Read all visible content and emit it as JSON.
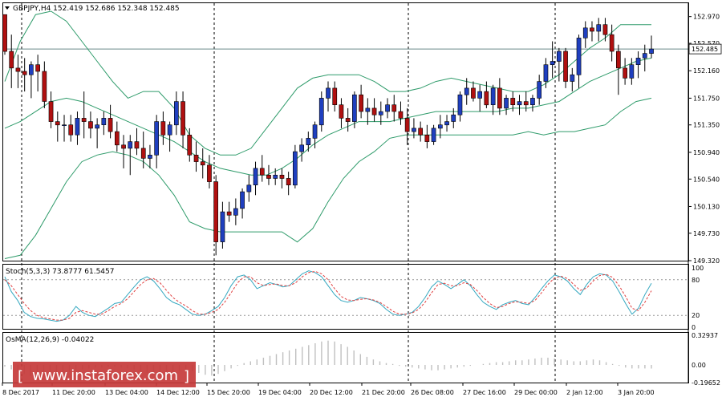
{
  "header": {
    "main_info": "GBPJPY,H4  152.419 152.686 152.348 152.485",
    "stoch_info": "Stoch(5,3,3) 73.8777 61.5457",
    "osma_info": "OsMA(12,26,9) -0.04022"
  },
  "watermark": {
    "text": "www.instaforex.com"
  },
  "colors": {
    "bull": "#1f3fbf",
    "bear": "#b01010",
    "bands": "#2e9b6a",
    "stoch_main": "#35a8c0",
    "stoch_signal": "#e04040",
    "osma": "#c0c0c0",
    "watermark_bg": "#c53a3a"
  },
  "chart_data": {
    "type": "candlestick",
    "symbol": "GBPJPY",
    "timeframe": "H4",
    "price_axis": {
      "ylim": [
        149.32,
        153.17
      ],
      "ticks": [
        "152.970",
        "152.570",
        "152.160",
        "151.750",
        "151.350",
        "150.940",
        "150.540",
        "150.130",
        "149.730",
        "149.320"
      ],
      "current_price": "152.485"
    },
    "time_axis": {
      "labels": [
        "8 Dec 2017",
        "11 Dec 20:00",
        "13 Dec 04:00",
        "14 Dec 12:00",
        "15 Dec 20:00",
        "19 Dec 04:00",
        "20 Dec 12:00",
        "21 Dec 20:00",
        "26 Dec 08:00",
        "27 Dec 16:00",
        "29 Dec 00:00",
        "2 Jan 12:00",
        "3 Jan 20:00"
      ]
    },
    "ohlc": [
      [
        153.0,
        152.85,
        152.4,
        152.45
      ],
      [
        152.45,
        152.7,
        151.9,
        152.2
      ],
      [
        152.2,
        152.4,
        151.9,
        152.15
      ],
      [
        152.15,
        152.35,
        151.85,
        152.1
      ],
      [
        152.1,
        152.3,
        151.75,
        152.25
      ],
      [
        152.25,
        152.4,
        151.85,
        152.15
      ],
      [
        152.15,
        152.3,
        151.6,
        151.7
      ],
      [
        151.7,
        151.85,
        151.3,
        151.4
      ],
      [
        151.4,
        151.55,
        151.1,
        151.35
      ],
      [
        151.35,
        151.5,
        151.1,
        151.35
      ],
      [
        151.35,
        151.5,
        151.1,
        151.2
      ],
      [
        151.2,
        151.55,
        151.05,
        151.45
      ],
      [
        151.45,
        151.85,
        151.15,
        151.4
      ],
      [
        151.4,
        151.55,
        151.15,
        151.3
      ],
      [
        151.3,
        151.45,
        151.0,
        151.35
      ],
      [
        151.35,
        151.55,
        151.2,
        151.45
      ],
      [
        151.45,
        151.65,
        151.15,
        151.25
      ],
      [
        151.25,
        151.4,
        150.95,
        151.05
      ],
      [
        151.05,
        151.2,
        150.7,
        151.0
      ],
      [
        151.0,
        151.2,
        150.6,
        151.1
      ],
      [
        151.1,
        151.3,
        150.9,
        151.0
      ],
      [
        151.0,
        151.25,
        150.7,
        150.85
      ],
      [
        150.85,
        151.05,
        150.7,
        150.9
      ],
      [
        150.9,
        151.5,
        150.7,
        151.4
      ],
      [
        151.4,
        151.55,
        151.05,
        151.2
      ],
      [
        151.2,
        151.4,
        150.95,
        151.35
      ],
      [
        151.35,
        151.85,
        151.2,
        151.7
      ],
      [
        151.7,
        151.85,
        151.0,
        151.2
      ],
      [
        151.2,
        151.3,
        150.8,
        150.9
      ],
      [
        150.9,
        151.1,
        150.65,
        150.8
      ],
      [
        150.8,
        151.0,
        150.55,
        150.75
      ],
      [
        150.75,
        150.9,
        150.4,
        150.5
      ],
      [
        150.5,
        150.6,
        149.4,
        149.6
      ],
      [
        149.6,
        150.2,
        149.5,
        150.05
      ],
      [
        150.05,
        150.2,
        149.9,
        150.0
      ],
      [
        150.0,
        150.25,
        149.85,
        150.1
      ],
      [
        150.1,
        150.4,
        149.95,
        150.35
      ],
      [
        150.35,
        150.6,
        150.2,
        150.45
      ],
      [
        150.45,
        150.8,
        150.3,
        150.7
      ],
      [
        150.7,
        150.9,
        150.5,
        150.6
      ],
      [
        150.6,
        150.75,
        150.45,
        150.55
      ],
      [
        150.55,
        150.7,
        150.45,
        150.6
      ],
      [
        150.6,
        150.7,
        150.4,
        150.55
      ],
      [
        150.55,
        150.65,
        150.3,
        150.45
      ],
      [
        150.45,
        151.05,
        150.4,
        150.95
      ],
      [
        150.95,
        151.15,
        150.8,
        151.05
      ],
      [
        151.05,
        151.25,
        150.95,
        151.15
      ],
      [
        151.15,
        151.4,
        151.0,
        151.35
      ],
      [
        151.35,
        151.85,
        151.25,
        151.75
      ],
      [
        151.75,
        152.0,
        151.55,
        151.9
      ],
      [
        151.9,
        152.0,
        151.55,
        151.65
      ],
      [
        151.65,
        151.75,
        151.3,
        151.45
      ],
      [
        151.45,
        151.6,
        151.25,
        151.4
      ],
      [
        151.4,
        151.85,
        151.3,
        151.8
      ],
      [
        151.8,
        151.95,
        151.45,
        151.55
      ],
      [
        151.55,
        151.75,
        151.35,
        151.6
      ],
      [
        151.6,
        151.75,
        151.4,
        151.5
      ],
      [
        151.5,
        151.7,
        151.35,
        151.55
      ],
      [
        151.55,
        151.75,
        151.45,
        151.65
      ],
      [
        151.65,
        151.8,
        151.4,
        151.55
      ],
      [
        151.55,
        151.7,
        151.35,
        151.45
      ],
      [
        151.45,
        151.6,
        151.05,
        151.25
      ],
      [
        151.25,
        151.45,
        151.15,
        151.3
      ],
      [
        151.3,
        151.4,
        151.1,
        151.2
      ],
      [
        151.2,
        151.35,
        151.0,
        151.1
      ],
      [
        151.1,
        151.35,
        151.05,
        151.3
      ],
      [
        151.3,
        151.5,
        151.15,
        151.35
      ],
      [
        151.35,
        151.5,
        151.25,
        151.4
      ],
      [
        151.4,
        151.6,
        151.3,
        151.5
      ],
      [
        151.5,
        151.85,
        151.4,
        151.8
      ],
      [
        151.8,
        152.05,
        151.65,
        151.9
      ],
      [
        151.9,
        152.0,
        151.7,
        151.75
      ],
      [
        151.75,
        151.95,
        151.55,
        151.85
      ],
      [
        151.85,
        152.0,
        151.6,
        151.65
      ],
      [
        151.65,
        151.95,
        151.5,
        151.9
      ],
      [
        151.9,
        152.05,
        151.5,
        151.6
      ],
      [
        151.6,
        151.8,
        151.5,
        151.75
      ],
      [
        151.75,
        151.85,
        151.55,
        151.65
      ],
      [
        151.65,
        151.8,
        151.5,
        151.7
      ],
      [
        151.7,
        151.85,
        151.55,
        151.65
      ],
      [
        151.65,
        151.8,
        151.55,
        151.75
      ],
      [
        151.75,
        152.1,
        151.65,
        152.0
      ],
      [
        152.0,
        152.35,
        151.9,
        152.25
      ],
      [
        152.25,
        152.6,
        152.05,
        152.3
      ],
      [
        152.3,
        152.5,
        152.0,
        152.45
      ],
      [
        152.45,
        152.5,
        151.9,
        152.0
      ],
      [
        152.0,
        152.2,
        151.85,
        152.1
      ],
      [
        152.1,
        152.7,
        151.9,
        152.65
      ],
      [
        152.65,
        152.9,
        152.5,
        152.8
      ],
      [
        152.8,
        152.9,
        152.6,
        152.75
      ],
      [
        152.75,
        152.95,
        152.6,
        152.85
      ],
      [
        152.85,
        152.95,
        152.6,
        152.7
      ],
      [
        152.7,
        152.85,
        152.3,
        152.45
      ],
      [
        152.45,
        152.55,
        151.8,
        152.2
      ],
      [
        152.2,
        152.35,
        151.95,
        152.05
      ],
      [
        152.05,
        152.35,
        151.95,
        152.25
      ],
      [
        152.25,
        152.45,
        152.05,
        152.35
      ],
      [
        152.35,
        152.55,
        152.15,
        152.419
      ],
      [
        152.419,
        152.686,
        152.348,
        152.485
      ]
    ],
    "bands": {
      "upper": [
        152.0,
        152.6,
        153.0,
        153.05,
        152.9,
        152.6,
        152.3,
        152.0,
        151.75,
        151.85,
        151.85,
        151.6,
        151.2,
        151.0,
        150.9,
        150.9,
        151.0,
        151.3,
        151.6,
        151.9,
        152.05,
        152.1,
        152.1,
        152.1,
        152.0,
        151.85,
        151.85,
        151.9,
        152.0,
        152.05,
        152.0,
        151.95,
        151.9,
        151.85,
        151.85,
        151.95,
        152.1,
        152.3,
        152.5,
        152.65,
        152.85,
        152.85,
        152.85
      ],
      "middle": [
        151.3,
        151.4,
        151.55,
        151.7,
        151.75,
        151.7,
        151.6,
        151.5,
        151.4,
        151.3,
        151.2,
        151.1,
        150.95,
        150.8,
        150.7,
        150.65,
        150.6,
        150.6,
        150.7,
        150.85,
        151.05,
        151.2,
        151.3,
        151.4,
        151.4,
        151.4,
        151.45,
        151.5,
        151.55,
        151.55,
        151.55,
        151.55,
        151.55,
        151.6,
        151.6,
        151.65,
        151.7,
        151.85,
        152.0,
        152.1,
        152.2,
        152.3,
        152.35
      ],
      "lower": [
        149.35,
        149.4,
        149.7,
        150.1,
        150.5,
        150.8,
        150.9,
        150.95,
        150.9,
        150.8,
        150.6,
        150.3,
        149.9,
        149.8,
        149.75,
        149.75,
        149.75,
        149.75,
        149.75,
        149.6,
        149.8,
        150.2,
        150.55,
        150.8,
        150.95,
        151.15,
        151.2,
        151.2,
        151.2,
        151.2,
        151.2,
        151.2,
        151.2,
        151.2,
        151.25,
        151.2,
        151.25,
        151.25,
        151.3,
        151.35,
        151.55,
        151.7,
        151.75
      ]
    },
    "stochastic": {
      "label": "Stoch(5,3,3)",
      "main": 73.8777,
      "signal": 61.5457,
      "levels": [
        20,
        80
      ],
      "y_ticks": [
        "100",
        "80",
        "20",
        "0"
      ],
      "main_series": [
        85,
        60,
        45,
        25,
        18,
        15,
        14,
        12,
        10,
        12,
        20,
        35,
        25,
        20,
        18,
        25,
        32,
        40,
        42,
        55,
        68,
        80,
        85,
        78,
        65,
        50,
        42,
        38,
        30,
        22,
        20,
        22,
        28,
        35,
        50,
        70,
        85,
        88,
        80,
        65,
        70,
        75,
        72,
        68,
        70,
        80,
        90,
        95,
        92,
        85,
        70,
        55,
        45,
        42,
        45,
        50,
        48,
        45,
        40,
        30,
        22,
        20,
        22,
        25,
        35,
        50,
        68,
        78,
        72,
        65,
        72,
        80,
        70,
        55,
        42,
        35,
        30,
        38,
        42,
        45,
        40,
        38,
        50,
        65,
        78,
        88,
        85,
        78,
        65,
        55,
        72,
        85,
        90,
        88,
        78,
        60,
        40,
        22,
        32,
        55,
        74
      ],
      "signal_series": [
        80,
        70,
        55,
        40,
        28,
        20,
        16,
        14,
        12,
        12,
        15,
        25,
        28,
        25,
        22,
        22,
        28,
        35,
        40,
        48,
        60,
        72,
        80,
        82,
        75,
        62,
        50,
        42,
        36,
        28,
        22,
        22,
        25,
        30,
        42,
        58,
        75,
        85,
        85,
        75,
        70,
        72,
        73,
        70,
        70,
        75,
        85,
        92,
        94,
        90,
        80,
        65,
        52,
        46,
        45,
        47,
        48,
        46,
        42,
        35,
        27,
        22,
        22,
        24,
        30,
        42,
        58,
        72,
        74,
        70,
        70,
        75,
        72,
        62,
        50,
        40,
        33,
        35,
        40,
        43,
        42,
        40,
        45,
        58,
        72,
        83,
        86,
        82,
        72,
        62,
        66,
        78,
        87,
        89,
        84,
        70,
        52,
        32,
        28,
        42,
        61.5457
      ]
    },
    "osma": {
      "label": "OsMA(12,26,9)",
      "value": -0.04022,
      "y_ticks": [
        "0.32937",
        "0.00",
        "-0.19652"
      ],
      "ylim": [
        -0.19652,
        0.32937
      ],
      "values": [
        -0.02,
        -0.05,
        -0.08,
        -0.1,
        -0.12,
        -0.13,
        -0.13,
        -0.12,
        -0.11,
        -0.1,
        -0.08,
        -0.06,
        -0.05,
        -0.04,
        -0.03,
        -0.03,
        -0.02,
        -0.02,
        -0.03,
        -0.04,
        -0.05,
        -0.07,
        -0.09,
        -0.1,
        -0.1,
        -0.09,
        -0.08,
        -0.07,
        -0.06,
        -0.07,
        -0.09,
        -0.11,
        -0.12,
        -0.1,
        -0.07,
        -0.04,
        -0.01,
        0.02,
        0.04,
        0.06,
        0.08,
        0.1,
        0.12,
        0.14,
        0.16,
        0.18,
        0.2,
        0.22,
        0.24,
        0.26,
        0.27,
        0.26,
        0.23,
        0.2,
        0.16,
        0.12,
        0.09,
        0.06,
        0.04,
        0.02,
        0.01,
        -0.01,
        -0.02,
        -0.03,
        -0.04,
        -0.05,
        -0.06,
        -0.06,
        -0.05,
        -0.04,
        -0.03,
        -0.02,
        -0.01,
        0.0,
        0.01,
        0.02,
        0.03,
        0.03,
        0.04,
        0.05,
        0.05,
        0.06,
        0.07,
        0.08,
        0.08,
        0.07,
        0.06,
        0.05,
        0.04,
        0.04,
        0.05,
        0.06,
        0.05,
        0.03,
        0.01,
        -0.01,
        -0.03,
        -0.04,
        -0.04,
        -0.04,
        -0.04022
      ]
    }
  }
}
